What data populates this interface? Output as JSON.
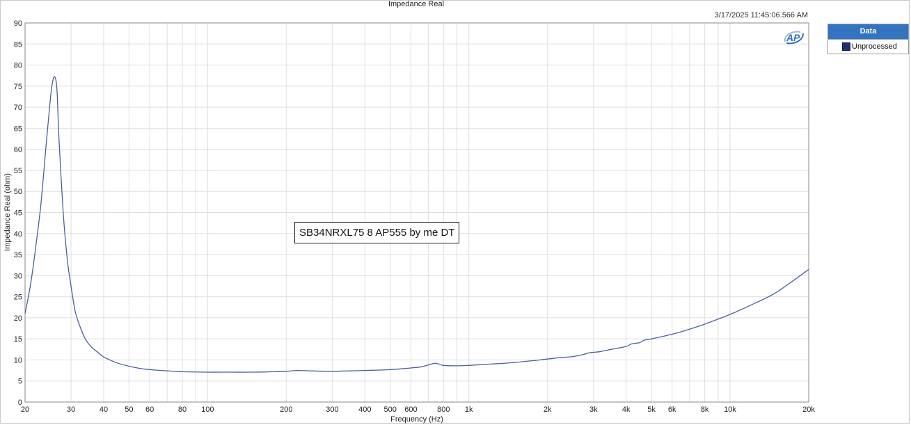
{
  "chart_data": {
    "type": "line",
    "title": "Impedance Real",
    "timestamp": "3/17/2025 11:45:06.566 AM",
    "xlabel": "Frequency (Hz)",
    "ylabel": "Impedance Real (ohm)",
    "x_scale": "log",
    "xlim": [
      20,
      20000
    ],
    "ylim": [
      0,
      90
    ],
    "grid": true,
    "legend_position": "right",
    "legend_title": "Data",
    "annotation": "SB34NRXL75 8 AP555 by me DT",
    "x_ticks": [
      {
        "value": 20,
        "label": "20"
      },
      {
        "value": 30,
        "label": "30"
      },
      {
        "value": 40,
        "label": "40"
      },
      {
        "value": 50,
        "label": "50"
      },
      {
        "value": 60,
        "label": "60"
      },
      {
        "value": 80,
        "label": "80"
      },
      {
        "value": 100,
        "label": "100"
      },
      {
        "value": 200,
        "label": "200"
      },
      {
        "value": 300,
        "label": "300"
      },
      {
        "value": 400,
        "label": "400"
      },
      {
        "value": 500,
        "label": "500"
      },
      {
        "value": 600,
        "label": "600"
      },
      {
        "value": 800,
        "label": "800"
      },
      {
        "value": 1000,
        "label": "1k"
      },
      {
        "value": 2000,
        "label": "2k"
      },
      {
        "value": 3000,
        "label": "3k"
      },
      {
        "value": 4000,
        "label": "4k"
      },
      {
        "value": 5000,
        "label": "5k"
      },
      {
        "value": 6000,
        "label": "6k"
      },
      {
        "value": 8000,
        "label": "8k"
      },
      {
        "value": 10000,
        "label": "10k"
      },
      {
        "value": 20000,
        "label": "20k"
      }
    ],
    "y_ticks": [
      0,
      5,
      10,
      15,
      20,
      25,
      30,
      35,
      40,
      45,
      50,
      55,
      60,
      65,
      70,
      75,
      80,
      85,
      90
    ],
    "series": [
      {
        "name": "Unprocessed",
        "color": "#4a5f9a",
        "x": [
          20,
          21,
          22,
          23,
          24,
          25,
          25.5,
          26,
          26.5,
          27,
          28,
          29,
          30,
          31,
          32,
          34,
          36,
          38,
          40,
          45,
          50,
          55,
          60,
          70,
          80,
          100,
          120,
          150,
          180,
          200,
          220,
          250,
          300,
          400,
          500,
          600,
          650,
          700,
          740,
          760,
          800,
          900,
          1000,
          1200,
          1500,
          2000,
          2200,
          2500,
          2700,
          2900,
          3000,
          3200,
          3500,
          4000,
          4200,
          4500,
          4700,
          5000,
          6000,
          7000,
          8000,
          10000,
          12000,
          15000,
          20000
        ],
        "y": [
          21,
          28,
          37,
          47,
          60,
          72,
          76,
          77.2,
          74,
          62,
          45,
          34,
          27.5,
          22,
          19,
          15,
          13,
          11.8,
          10.7,
          9.3,
          8.5,
          8,
          7.7,
          7.4,
          7.2,
          7.1,
          7.1,
          7.1,
          7.2,
          7.3,
          7.5,
          7.4,
          7.3,
          7.5,
          7.7,
          8.1,
          8.3,
          8.8,
          9.2,
          9.1,
          8.7,
          8.6,
          8.7,
          9,
          9.4,
          10.2,
          10.5,
          10.8,
          11.2,
          11.7,
          11.8,
          12,
          12.5,
          13.2,
          13.8,
          14.1,
          14.7,
          15,
          16.1,
          17.3,
          18.5,
          20.8,
          23,
          26,
          31.5
        ]
      }
    ]
  }
}
